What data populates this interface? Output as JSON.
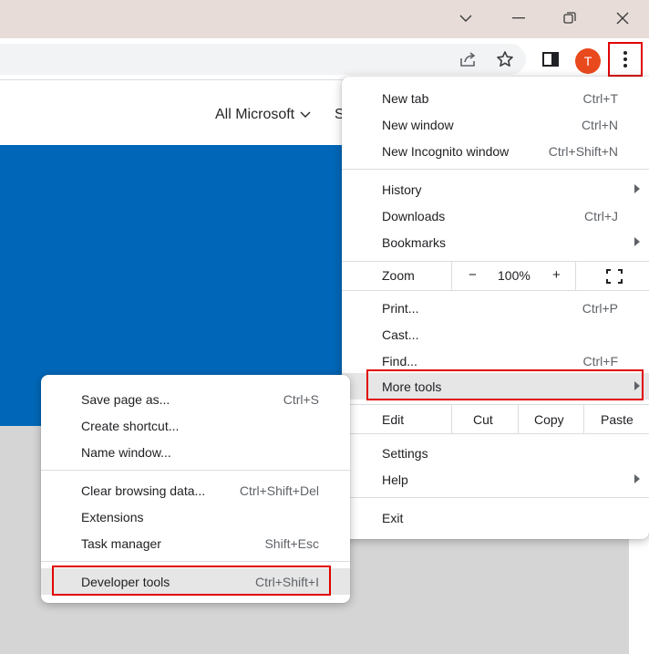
{
  "window": {
    "controls": [
      "chevron-down",
      "minimize",
      "restore",
      "close"
    ]
  },
  "toolbar": {
    "avatar_letter": "T"
  },
  "page": {
    "nav_all_microsoft": "All Microsoft",
    "nav_partial": "S",
    "colors": {
      "hero": "#0067b8",
      "gray": "#d5d5d5"
    }
  },
  "main_menu": {
    "new_tab": {
      "label": "New tab",
      "shortcut": "Ctrl+T"
    },
    "new_window": {
      "label": "New window",
      "shortcut": "Ctrl+N"
    },
    "new_incognito": {
      "label": "New Incognito window",
      "shortcut": "Ctrl+Shift+N"
    },
    "history": {
      "label": "History"
    },
    "downloads": {
      "label": "Downloads",
      "shortcut": "Ctrl+J"
    },
    "bookmarks": {
      "label": "Bookmarks"
    },
    "zoom": {
      "label": "Zoom",
      "minus": "−",
      "value": "100%",
      "plus": "+"
    },
    "print": {
      "label": "Print...",
      "shortcut": "Ctrl+P"
    },
    "cast": {
      "label": "Cast..."
    },
    "find": {
      "label": "Find...",
      "shortcut": "Ctrl+F"
    },
    "more_tools": {
      "label": "More tools"
    },
    "edit": {
      "label": "Edit",
      "cut": "Cut",
      "copy": "Copy",
      "paste": "Paste"
    },
    "settings": {
      "label": "Settings"
    },
    "help": {
      "label": "Help"
    },
    "exit": {
      "label": "Exit"
    }
  },
  "sub_menu": {
    "save_page": {
      "label": "Save page as...",
      "shortcut": "Ctrl+S"
    },
    "create_shortcut": {
      "label": "Create shortcut..."
    },
    "name_window": {
      "label": "Name window..."
    },
    "clear_data": {
      "label": "Clear browsing data...",
      "shortcut": "Ctrl+Shift+Del"
    },
    "extensions": {
      "label": "Extensions"
    },
    "task_manager": {
      "label": "Task manager",
      "shortcut": "Shift+Esc"
    },
    "dev_tools": {
      "label": "Developer tools",
      "shortcut": "Ctrl+Shift+I"
    }
  },
  "colors": {
    "accent_red": "#e00000",
    "avatar": "#e8491d",
    "titlebar": "#e7dcd8"
  }
}
